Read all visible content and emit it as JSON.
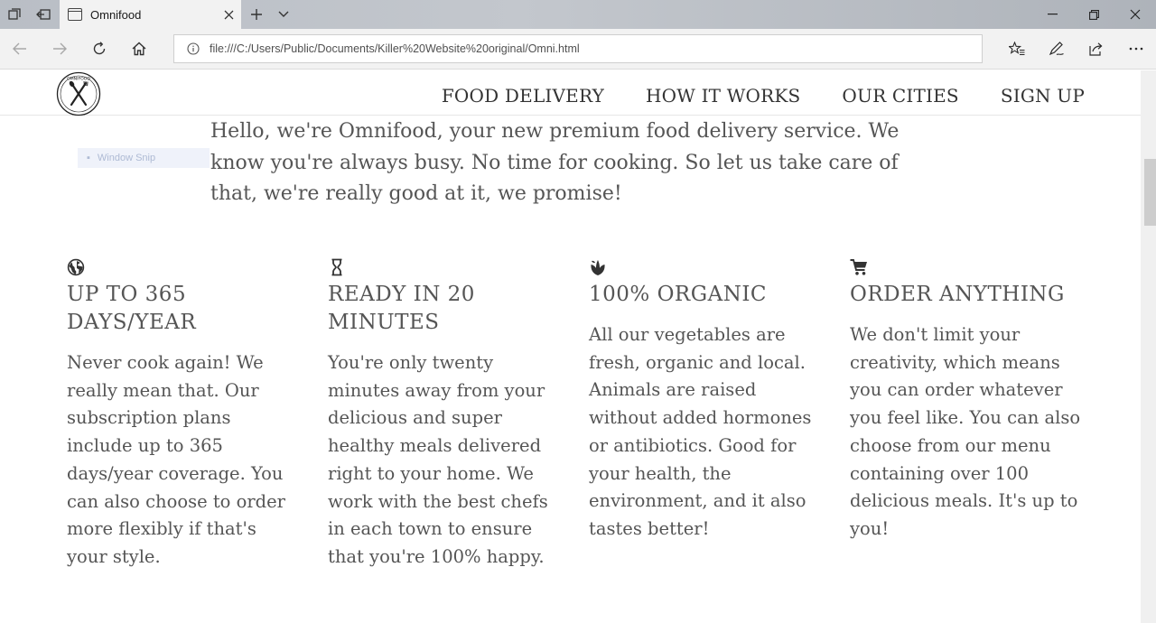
{
  "browser": {
    "tab_title": "Omnifood",
    "url": "file:///C:/Users/Public/Documents/Killer%20Website%20original/Omni.html"
  },
  "site": {
    "logo_text_top": "OMNIFOOD",
    "nav": [
      "FOOD DELIVERY",
      "HOW IT WORKS",
      "OUR CITIES",
      "SIGN UP"
    ],
    "overlay_hint": "Window Snip",
    "intro": "Hello, we're Omnifood, your new premium food delivery service. We know you're always busy. No time for cooking. So let us take care of that, we're really good at it, we promise!",
    "features": [
      {
        "icon": "globe-icon",
        "title": "Up to 365 days/year",
        "text": "Never cook again! We really mean that. Our subscription plans include up to 365 days/year coverage. You can also choose to order more flexibly if that's your style."
      },
      {
        "icon": "hourglass-icon",
        "title": "Ready in 20 minutes",
        "text": "You're only twenty minutes away from your delicious and super healthy meals delivered right to your home. We work with the best chefs in each town to ensure that you're 100% happy."
      },
      {
        "icon": "leaf-icon",
        "title": "100% organic",
        "text": "All our vegetables are fresh, organic and local. Animals are raised without added hormones or antibiotics. Good for your health, the environment, and it also tastes better!"
      },
      {
        "icon": "cart-icon",
        "title": "Order anything",
        "text": "We don't limit your creativity, which means you can order whatever you feel like. You can also choose from our menu containing over 100 delicious meals. It's up to you!"
      }
    ]
  }
}
